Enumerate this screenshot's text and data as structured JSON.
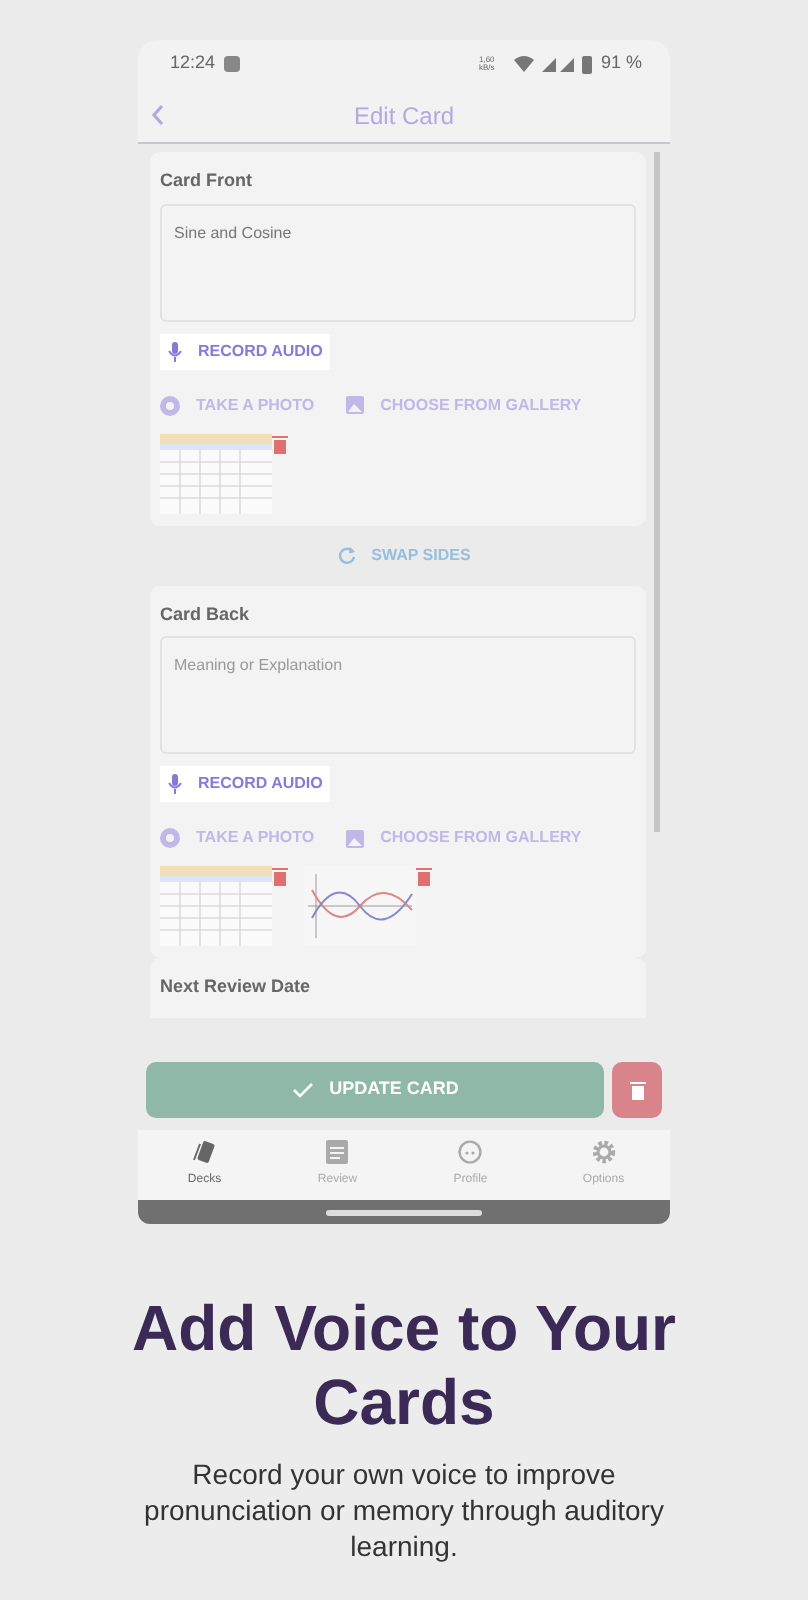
{
  "status_bar": {
    "time": "12:24",
    "speed": "1,60 kB/s",
    "battery": "91 %"
  },
  "header": {
    "title": "Edit Card"
  },
  "sides": [
    {
      "label": "Card Front",
      "value": "Sine and Cosine",
      "record": "RECORD AUDIO",
      "record_highlighted": true,
      "photo": "TAKE A PHOTO",
      "gallery": "CHOOSE FROM GALLERY"
    },
    {
      "label": "Card Back",
      "placeholder": "Meaning or Explanation",
      "record": "RECORD AUDIO",
      "record_highlighted": true,
      "photo": "TAKE A PHOTO",
      "gallery": "CHOOSE FROM GALLERY"
    }
  ],
  "swap": "SWAP SIDES",
  "next_review": {
    "label": "Next Review Date"
  },
  "update_button": "UPDATE CARD",
  "nav": [
    {
      "label": "Decks",
      "selected": true
    },
    {
      "label": "Review",
      "selected": false
    },
    {
      "label": "Profile",
      "selected": false
    },
    {
      "label": "Options",
      "selected": false
    }
  ],
  "headline": "Add Voice to Your Cards",
  "subtitle": "Record your own voice to improve pronunciation or memory through auditory learning."
}
